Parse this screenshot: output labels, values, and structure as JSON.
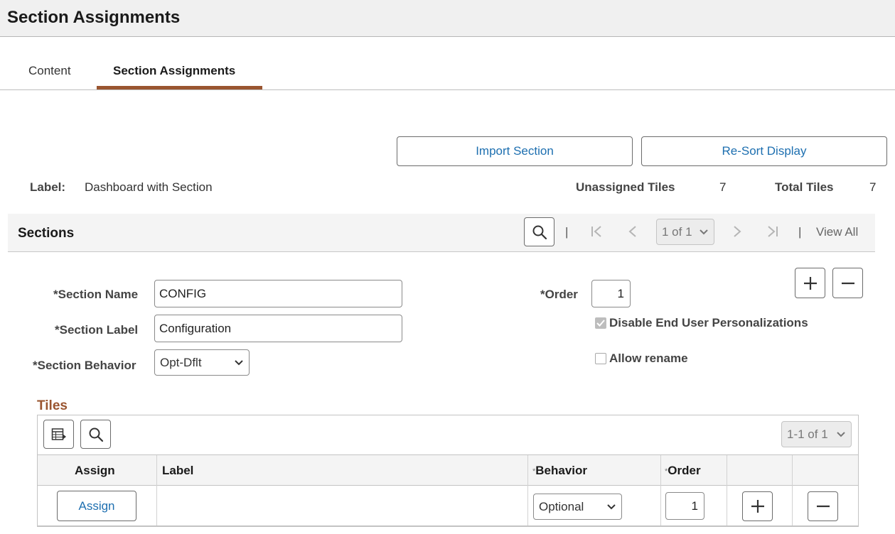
{
  "header": {
    "title": "Section Assignments"
  },
  "tabs": [
    {
      "label": "Content"
    },
    {
      "label": "Section Assignments"
    }
  ],
  "actions": {
    "import_label": "Import Section",
    "resort_label": "Re-Sort Display"
  },
  "summary": {
    "label_caption": "Label:",
    "label_value": "Dashboard with Section",
    "unassigned_caption": "Unassigned Tiles",
    "unassigned_value": "7",
    "total_caption": "Total Tiles",
    "total_value": "7"
  },
  "sections": {
    "title": "Sections",
    "pager": {
      "value": "1 of 1",
      "view_all": "View All",
      "separator": "|"
    },
    "fields": {
      "name_label": "*Section Name",
      "name_value": "CONFIG",
      "label_label": "*Section Label",
      "label_value": "Configuration",
      "behavior_label": "*Section Behavior",
      "behavior_value": "Opt-Dflt",
      "order_label": "*Order",
      "order_value": "1",
      "disable_personalization_label": "Disable End User Personalizations",
      "disable_personalization_checked": true,
      "allow_rename_label": "Allow rename",
      "allow_rename_checked": false
    }
  },
  "tiles": {
    "title": "Tiles",
    "pager": {
      "value": "1-1 of 1"
    },
    "columns": [
      {
        "label": "Assign",
        "required": false
      },
      {
        "label": "Label",
        "required": false
      },
      {
        "label": "Behavior",
        "required": true
      },
      {
        "label": "Order",
        "required": true
      }
    ],
    "required_mark": "*",
    "rows": [
      {
        "assign_label": "Assign",
        "label": "",
        "behavior": "Optional",
        "order": "1"
      }
    ]
  },
  "icons": {
    "search": "search-icon",
    "first": "first-page-icon",
    "prev": "previous-icon",
    "next": "next-icon",
    "last": "last-page-icon",
    "add": "plus-icon",
    "remove": "minus-icon",
    "personalize": "grid-personalize-icon",
    "chevron": "chevron-down-icon"
  },
  "colors": {
    "accent": "#9a5530",
    "link": "#1d6fb0"
  }
}
